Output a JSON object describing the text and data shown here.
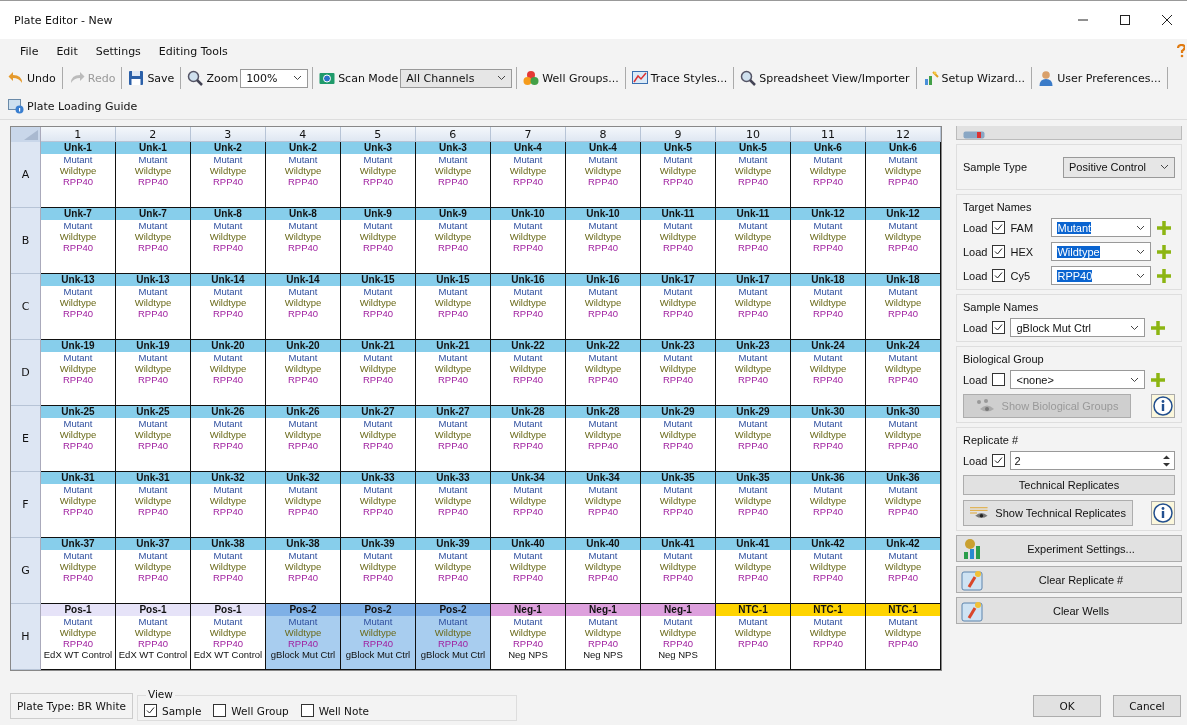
{
  "window": {
    "title": "Plate Editor - New"
  },
  "menu": [
    {
      "label": "File"
    },
    {
      "label": "Edit"
    },
    {
      "label": "Settings"
    },
    {
      "label": "Editing Tools"
    }
  ],
  "toolbar": [
    {
      "kind": "button",
      "label": "Undo",
      "disabled": false
    },
    {
      "kind": "button",
      "label": "Redo",
      "disabled": true
    },
    {
      "kind": "button",
      "label": "Save",
      "disabled": false
    },
    {
      "kind": "combo",
      "label": "Zoom",
      "value": "100%",
      "disabled": false
    },
    {
      "kind": "combo",
      "label": "Scan Mode",
      "value": "All Channels",
      "disabled": false
    },
    {
      "kind": "button",
      "label": "Well Groups...",
      "disabled": false
    },
    {
      "kind": "button",
      "label": "Trace Styles...",
      "disabled": false
    },
    {
      "kind": "button",
      "label": "Spreadsheet View/Importer",
      "disabled": false
    },
    {
      "kind": "button",
      "label": "Setup Wizard...",
      "disabled": false
    },
    {
      "kind": "button",
      "label": "User Preferences...",
      "disabled": false
    }
  ],
  "guide_button": "Plate Loading Guide",
  "plate": {
    "columns": [
      "1",
      "2",
      "3",
      "4",
      "5",
      "6",
      "7",
      "8",
      "9",
      "10",
      "11",
      "12"
    ],
    "rows": [
      {
        "label": "A",
        "wells": [
          {
            "name": "Unk-1",
            "kind": "unknown",
            "targets": [
              "Mutant",
              "Wildtype",
              "RPP40"
            ],
            "selected": false
          },
          {
            "name": "Unk-1",
            "kind": "unknown",
            "targets": [
              "Mutant",
              "Wildtype",
              "RPP40"
            ],
            "selected": false
          },
          {
            "name": "Unk-2",
            "kind": "unknown",
            "targets": [
              "Mutant",
              "Wildtype",
              "RPP40"
            ],
            "selected": false
          },
          {
            "name": "Unk-2",
            "kind": "unknown",
            "targets": [
              "Mutant",
              "Wildtype",
              "RPP40"
            ],
            "selected": false
          },
          {
            "name": "Unk-3",
            "kind": "unknown",
            "targets": [
              "Mutant",
              "Wildtype",
              "RPP40"
            ],
            "selected": false
          },
          {
            "name": "Unk-3",
            "kind": "unknown",
            "targets": [
              "Mutant",
              "Wildtype",
              "RPP40"
            ],
            "selected": false
          },
          {
            "name": "Unk-4",
            "kind": "unknown",
            "targets": [
              "Mutant",
              "Wildtype",
              "RPP40"
            ],
            "selected": false
          },
          {
            "name": "Unk-4",
            "kind": "unknown",
            "targets": [
              "Mutant",
              "Wildtype",
              "RPP40"
            ],
            "selected": false
          },
          {
            "name": "Unk-5",
            "kind": "unknown",
            "targets": [
              "Mutant",
              "Wildtype",
              "RPP40"
            ],
            "selected": false
          },
          {
            "name": "Unk-5",
            "kind": "unknown",
            "targets": [
              "Mutant",
              "Wildtype",
              "RPP40"
            ],
            "selected": false
          },
          {
            "name": "Unk-6",
            "kind": "unknown",
            "targets": [
              "Mutant",
              "Wildtype",
              "RPP40"
            ],
            "selected": false
          },
          {
            "name": "Unk-6",
            "kind": "unknown",
            "targets": [
              "Mutant",
              "Wildtype",
              "RPP40"
            ],
            "selected": false
          }
        ]
      },
      {
        "label": "B",
        "wells": [
          {
            "name": "Unk-7",
            "kind": "unknown",
            "targets": [
              "Mutant",
              "Wildtype",
              "RPP40"
            ],
            "selected": false
          },
          {
            "name": "Unk-7",
            "kind": "unknown",
            "targets": [
              "Mutant",
              "Wildtype",
              "RPP40"
            ],
            "selected": false
          },
          {
            "name": "Unk-8",
            "kind": "unknown",
            "targets": [
              "Mutant",
              "Wildtype",
              "RPP40"
            ],
            "selected": false
          },
          {
            "name": "Unk-8",
            "kind": "unknown",
            "targets": [
              "Mutant",
              "Wildtype",
              "RPP40"
            ],
            "selected": false
          },
          {
            "name": "Unk-9",
            "kind": "unknown",
            "targets": [
              "Mutant",
              "Wildtype",
              "RPP40"
            ],
            "selected": false
          },
          {
            "name": "Unk-9",
            "kind": "unknown",
            "targets": [
              "Mutant",
              "Wildtype",
              "RPP40"
            ],
            "selected": false
          },
          {
            "name": "Unk-10",
            "kind": "unknown",
            "targets": [
              "Mutant",
              "Wildtype",
              "RPP40"
            ],
            "selected": false
          },
          {
            "name": "Unk-10",
            "kind": "unknown",
            "targets": [
              "Mutant",
              "Wildtype",
              "RPP40"
            ],
            "selected": false
          },
          {
            "name": "Unk-11",
            "kind": "unknown",
            "targets": [
              "Mutant",
              "Wildtype",
              "RPP40"
            ],
            "selected": false
          },
          {
            "name": "Unk-11",
            "kind": "unknown",
            "targets": [
              "Mutant",
              "Wildtype",
              "RPP40"
            ],
            "selected": false
          },
          {
            "name": "Unk-12",
            "kind": "unknown",
            "targets": [
              "Mutant",
              "Wildtype",
              "RPP40"
            ],
            "selected": false
          },
          {
            "name": "Unk-12",
            "kind": "unknown",
            "targets": [
              "Mutant",
              "Wildtype",
              "RPP40"
            ],
            "selected": false
          }
        ]
      },
      {
        "label": "C",
        "wells": [
          {
            "name": "Unk-13",
            "kind": "unknown",
            "targets": [
              "Mutant",
              "Wildtype",
              "RPP40"
            ],
            "selected": false
          },
          {
            "name": "Unk-13",
            "kind": "unknown",
            "targets": [
              "Mutant",
              "Wildtype",
              "RPP40"
            ],
            "selected": false
          },
          {
            "name": "Unk-14",
            "kind": "unknown",
            "targets": [
              "Mutant",
              "Wildtype",
              "RPP40"
            ],
            "selected": false
          },
          {
            "name": "Unk-14",
            "kind": "unknown",
            "targets": [
              "Mutant",
              "Wildtype",
              "RPP40"
            ],
            "selected": false
          },
          {
            "name": "Unk-15",
            "kind": "unknown",
            "targets": [
              "Mutant",
              "Wildtype",
              "RPP40"
            ],
            "selected": false
          },
          {
            "name": "Unk-15",
            "kind": "unknown",
            "targets": [
              "Mutant",
              "Wildtype",
              "RPP40"
            ],
            "selected": false
          },
          {
            "name": "Unk-16",
            "kind": "unknown",
            "targets": [
              "Mutant",
              "Wildtype",
              "RPP40"
            ],
            "selected": false
          },
          {
            "name": "Unk-16",
            "kind": "unknown",
            "targets": [
              "Mutant",
              "Wildtype",
              "RPP40"
            ],
            "selected": false
          },
          {
            "name": "Unk-17",
            "kind": "unknown",
            "targets": [
              "Mutant",
              "Wildtype",
              "RPP40"
            ],
            "selected": false
          },
          {
            "name": "Unk-17",
            "kind": "unknown",
            "targets": [
              "Mutant",
              "Wildtype",
              "RPP40"
            ],
            "selected": false
          },
          {
            "name": "Unk-18",
            "kind": "unknown",
            "targets": [
              "Mutant",
              "Wildtype",
              "RPP40"
            ],
            "selected": false
          },
          {
            "name": "Unk-18",
            "kind": "unknown",
            "targets": [
              "Mutant",
              "Wildtype",
              "RPP40"
            ],
            "selected": false
          }
        ]
      },
      {
        "label": "D",
        "wells": [
          {
            "name": "Unk-19",
            "kind": "unknown",
            "targets": [
              "Mutant",
              "Wildtype",
              "RPP40"
            ],
            "selected": false
          },
          {
            "name": "Unk-19",
            "kind": "unknown",
            "targets": [
              "Mutant",
              "Wildtype",
              "RPP40"
            ],
            "selected": false
          },
          {
            "name": "Unk-20",
            "kind": "unknown",
            "targets": [
              "Mutant",
              "Wildtype",
              "RPP40"
            ],
            "selected": false
          },
          {
            "name": "Unk-20",
            "kind": "unknown",
            "targets": [
              "Mutant",
              "Wildtype",
              "RPP40"
            ],
            "selected": false
          },
          {
            "name": "Unk-21",
            "kind": "unknown",
            "targets": [
              "Mutant",
              "Wildtype",
              "RPP40"
            ],
            "selected": false
          },
          {
            "name": "Unk-21",
            "kind": "unknown",
            "targets": [
              "Mutant",
              "Wildtype",
              "RPP40"
            ],
            "selected": false
          },
          {
            "name": "Unk-22",
            "kind": "unknown",
            "targets": [
              "Mutant",
              "Wildtype",
              "RPP40"
            ],
            "selected": false
          },
          {
            "name": "Unk-22",
            "kind": "unknown",
            "targets": [
              "Mutant",
              "Wildtype",
              "RPP40"
            ],
            "selected": false
          },
          {
            "name": "Unk-23",
            "kind": "unknown",
            "targets": [
              "Mutant",
              "Wildtype",
              "RPP40"
            ],
            "selected": false
          },
          {
            "name": "Unk-23",
            "kind": "unknown",
            "targets": [
              "Mutant",
              "Wildtype",
              "RPP40"
            ],
            "selected": false
          },
          {
            "name": "Unk-24",
            "kind": "unknown",
            "targets": [
              "Mutant",
              "Wildtype",
              "RPP40"
            ],
            "selected": false
          },
          {
            "name": "Unk-24",
            "kind": "unknown",
            "targets": [
              "Mutant",
              "Wildtype",
              "RPP40"
            ],
            "selected": false
          }
        ]
      },
      {
        "label": "E",
        "wells": [
          {
            "name": "Unk-25",
            "kind": "unknown",
            "targets": [
              "Mutant",
              "Wildtype",
              "RPP40"
            ],
            "selected": false
          },
          {
            "name": "Unk-25",
            "kind": "unknown",
            "targets": [
              "Mutant",
              "Wildtype",
              "RPP40"
            ],
            "selected": false
          },
          {
            "name": "Unk-26",
            "kind": "unknown",
            "targets": [
              "Mutant",
              "Wildtype",
              "RPP40"
            ],
            "selected": false
          },
          {
            "name": "Unk-26",
            "kind": "unknown",
            "targets": [
              "Mutant",
              "Wildtype",
              "RPP40"
            ],
            "selected": false
          },
          {
            "name": "Unk-27",
            "kind": "unknown",
            "targets": [
              "Mutant",
              "Wildtype",
              "RPP40"
            ],
            "selected": false
          },
          {
            "name": "Unk-27",
            "kind": "unknown",
            "targets": [
              "Mutant",
              "Wildtype",
              "RPP40"
            ],
            "selected": false
          },
          {
            "name": "Unk-28",
            "kind": "unknown",
            "targets": [
              "Mutant",
              "Wildtype",
              "RPP40"
            ],
            "selected": false
          },
          {
            "name": "Unk-28",
            "kind": "unknown",
            "targets": [
              "Mutant",
              "Wildtype",
              "RPP40"
            ],
            "selected": false
          },
          {
            "name": "Unk-29",
            "kind": "unknown",
            "targets": [
              "Mutant",
              "Wildtype",
              "RPP40"
            ],
            "selected": false
          },
          {
            "name": "Unk-29",
            "kind": "unknown",
            "targets": [
              "Mutant",
              "Wildtype",
              "RPP40"
            ],
            "selected": false
          },
          {
            "name": "Unk-30",
            "kind": "unknown",
            "targets": [
              "Mutant",
              "Wildtype",
              "RPP40"
            ],
            "selected": false
          },
          {
            "name": "Unk-30",
            "kind": "unknown",
            "targets": [
              "Mutant",
              "Wildtype",
              "RPP40"
            ],
            "selected": false
          }
        ]
      },
      {
        "label": "F",
        "wells": [
          {
            "name": "Unk-31",
            "kind": "unknown",
            "targets": [
              "Mutant",
              "Wildtype",
              "RPP40"
            ],
            "selected": false
          },
          {
            "name": "Unk-31",
            "kind": "unknown",
            "targets": [
              "Mutant",
              "Wildtype",
              "RPP40"
            ],
            "selected": false
          },
          {
            "name": "Unk-32",
            "kind": "unknown",
            "targets": [
              "Mutant",
              "Wildtype",
              "RPP40"
            ],
            "selected": false
          },
          {
            "name": "Unk-32",
            "kind": "unknown",
            "targets": [
              "Mutant",
              "Wildtype",
              "RPP40"
            ],
            "selected": false
          },
          {
            "name": "Unk-33",
            "kind": "unknown",
            "targets": [
              "Mutant",
              "Wildtype",
              "RPP40"
            ],
            "selected": false
          },
          {
            "name": "Unk-33",
            "kind": "unknown",
            "targets": [
              "Mutant",
              "Wildtype",
              "RPP40"
            ],
            "selected": false
          },
          {
            "name": "Unk-34",
            "kind": "unknown",
            "targets": [
              "Mutant",
              "Wildtype",
              "RPP40"
            ],
            "selected": false
          },
          {
            "name": "Unk-34",
            "kind": "unknown",
            "targets": [
              "Mutant",
              "Wildtype",
              "RPP40"
            ],
            "selected": false
          },
          {
            "name": "Unk-35",
            "kind": "unknown",
            "targets": [
              "Mutant",
              "Wildtype",
              "RPP40"
            ],
            "selected": false
          },
          {
            "name": "Unk-35",
            "kind": "unknown",
            "targets": [
              "Mutant",
              "Wildtype",
              "RPP40"
            ],
            "selected": false
          },
          {
            "name": "Unk-36",
            "kind": "unknown",
            "targets": [
              "Mutant",
              "Wildtype",
              "RPP40"
            ],
            "selected": false
          },
          {
            "name": "Unk-36",
            "kind": "unknown",
            "targets": [
              "Mutant",
              "Wildtype",
              "RPP40"
            ],
            "selected": false
          }
        ]
      },
      {
        "label": "G",
        "wells": [
          {
            "name": "Unk-37",
            "kind": "unknown",
            "targets": [
              "Mutant",
              "Wildtype",
              "RPP40"
            ],
            "selected": false
          },
          {
            "name": "Unk-37",
            "kind": "unknown",
            "targets": [
              "Mutant",
              "Wildtype",
              "RPP40"
            ],
            "selected": false
          },
          {
            "name": "Unk-38",
            "kind": "unknown",
            "targets": [
              "Mutant",
              "Wildtype",
              "RPP40"
            ],
            "selected": false
          },
          {
            "name": "Unk-38",
            "kind": "unknown",
            "targets": [
              "Mutant",
              "Wildtype",
              "RPP40"
            ],
            "selected": false
          },
          {
            "name": "Unk-39",
            "kind": "unknown",
            "targets": [
              "Mutant",
              "Wildtype",
              "RPP40"
            ],
            "selected": false
          },
          {
            "name": "Unk-39",
            "kind": "unknown",
            "targets": [
              "Mutant",
              "Wildtype",
              "RPP40"
            ],
            "selected": false
          },
          {
            "name": "Unk-40",
            "kind": "unknown",
            "targets": [
              "Mutant",
              "Wildtype",
              "RPP40"
            ],
            "selected": false
          },
          {
            "name": "Unk-40",
            "kind": "unknown",
            "targets": [
              "Mutant",
              "Wildtype",
              "RPP40"
            ],
            "selected": false
          },
          {
            "name": "Unk-41",
            "kind": "unknown",
            "targets": [
              "Mutant",
              "Wildtype",
              "RPP40"
            ],
            "selected": false
          },
          {
            "name": "Unk-41",
            "kind": "unknown",
            "targets": [
              "Mutant",
              "Wildtype",
              "RPP40"
            ],
            "selected": false
          },
          {
            "name": "Unk-42",
            "kind": "unknown",
            "targets": [
              "Mutant",
              "Wildtype",
              "RPP40"
            ],
            "selected": false
          },
          {
            "name": "Unk-42",
            "kind": "unknown",
            "targets": [
              "Mutant",
              "Wildtype",
              "RPP40"
            ],
            "selected": false
          }
        ]
      },
      {
        "label": "H",
        "wells": [
          {
            "name": "Pos-1",
            "kind": "positive",
            "targets": [
              "Mutant",
              "Wildtype",
              "RPP40"
            ],
            "sample": "EdX WT Control",
            "selected": false
          },
          {
            "name": "Pos-1",
            "kind": "positive",
            "targets": [
              "Mutant",
              "Wildtype",
              "RPP40"
            ],
            "sample": "EdX WT Control",
            "selected": false
          },
          {
            "name": "Pos-1",
            "kind": "positive",
            "targets": [
              "Mutant",
              "Wildtype",
              "RPP40"
            ],
            "sample": "EdX WT Control",
            "selected": false
          },
          {
            "name": "Pos-2",
            "kind": "positive",
            "targets": [
              "Mutant",
              "Wildtype",
              "RPP40"
            ],
            "sample": "gBlock Mut Ctrl",
            "selected": true
          },
          {
            "name": "Pos-2",
            "kind": "positive",
            "targets": [
              "Mutant",
              "Wildtype",
              "RPP40"
            ],
            "sample": "gBlock Mut Ctrl",
            "selected": true
          },
          {
            "name": "Pos-2",
            "kind": "positive",
            "targets": [
              "Mutant",
              "Wildtype",
              "RPP40"
            ],
            "sample": "gBlock Mut Ctrl",
            "selected": true
          },
          {
            "name": "Neg-1",
            "kind": "negative",
            "targets": [
              "Mutant",
              "Wildtype",
              "RPP40"
            ],
            "sample": "Neg NPS",
            "selected": false
          },
          {
            "name": "Neg-1",
            "kind": "negative",
            "targets": [
              "Mutant",
              "Wildtype",
              "RPP40"
            ],
            "sample": "Neg NPS",
            "selected": false
          },
          {
            "name": "Neg-1",
            "kind": "negative",
            "targets": [
              "Mutant",
              "Wildtype",
              "RPP40"
            ],
            "sample": "Neg NPS",
            "selected": false
          },
          {
            "name": "NTC-1",
            "kind": "ntc",
            "targets": [
              "Mutant",
              "Wildtype",
              "RPP40"
            ],
            "selected": false
          },
          {
            "name": "NTC-1",
            "kind": "ntc",
            "targets": [
              "Mutant",
              "Wildtype",
              "RPP40"
            ],
            "selected": false
          },
          {
            "name": "NTC-1",
            "kind": "ntc",
            "targets": [
              "Mutant",
              "Wildtype",
              "RPP40"
            ],
            "selected": false
          }
        ]
      }
    ]
  },
  "side_panel": {
    "sample_type": {
      "label": "Sample Type",
      "value": "Positive Control"
    },
    "target_names": {
      "title": "Target Names",
      "rows": [
        {
          "load": "Load",
          "checked": true,
          "channel": "FAM",
          "value": "Mutant",
          "text_selected": true
        },
        {
          "load": "Load",
          "checked": true,
          "channel": "HEX",
          "value": "Wildtype",
          "text_selected": true
        },
        {
          "load": "Load",
          "checked": true,
          "channel": "Cy5",
          "value": "RPP40",
          "text_selected": true
        }
      ]
    },
    "sample_names": {
      "title": "Sample Names",
      "load": "Load",
      "checked": true,
      "value": "gBlock Mut Ctrl"
    },
    "biological_group": {
      "title": "Biological Group",
      "load": "Load",
      "checked": false,
      "value": "<none>",
      "show_button": {
        "label": "Show Biological Groups",
        "disabled": true
      }
    },
    "replicate": {
      "title": "Replicate #",
      "load": "Load",
      "checked": true,
      "value": "2",
      "technical_button": "Technical Replicates",
      "show_button": "Show Technical Replicates"
    },
    "action_buttons": [
      {
        "label": "Experiment Settings..."
      },
      {
        "label": "Clear Replicate #"
      },
      {
        "label": "Clear Wells"
      }
    ]
  },
  "status": {
    "plate_type": "Plate Type: BR White",
    "view": {
      "title": "View",
      "options": [
        {
          "label": "Sample",
          "checked": true
        },
        {
          "label": "Well Group",
          "checked": false
        },
        {
          "label": "Well Note",
          "checked": false
        }
      ]
    }
  },
  "dialog_buttons": [
    {
      "label": "OK"
    },
    {
      "label": "Cancel"
    }
  ]
}
